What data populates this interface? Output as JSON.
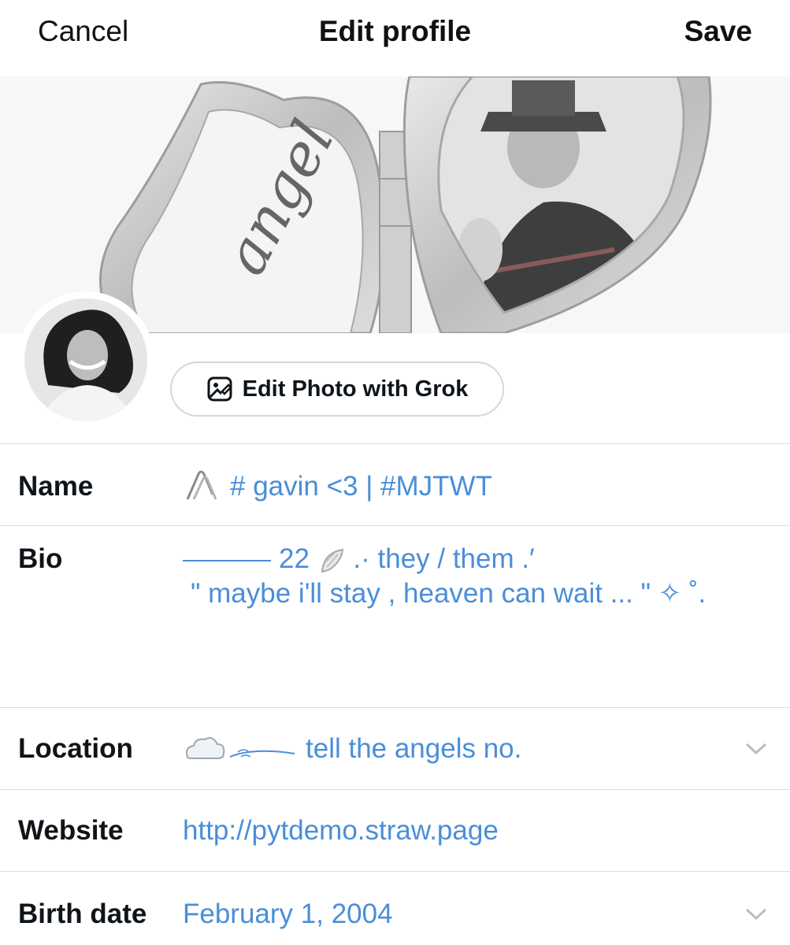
{
  "header": {
    "cancel_label": "Cancel",
    "title": "Edit profile",
    "save_label": "Save"
  },
  "banner": {
    "locket_engraving": "angel"
  },
  "photo_actions": {
    "edit_with_grok_label": "Edit Photo with Grok"
  },
  "fields": {
    "name": {
      "label": "Name",
      "value": "# gavin <3 | #MJTWT",
      "icon": "paperclip-icon"
    },
    "bio": {
      "label": "Bio",
      "line1": "22",
      "line1b": ".· they / them .′",
      "line2": "\" maybe i'll stay , heaven can wait ... \" ✧ ˚.",
      "icon": "wing-icon"
    },
    "location": {
      "label": "Location",
      "value": "tell the angels no.",
      "icon": "cloud-icon"
    },
    "website": {
      "label": "Website",
      "value": "http://pytdemo.straw.page"
    },
    "birth_date": {
      "label": "Birth date",
      "value": "February 1, 2004"
    }
  },
  "colors": {
    "value_text": "#4a8ed8",
    "label_text": "#0f1419",
    "divider": "#dcdde0",
    "button_border": "#cfd9de"
  }
}
